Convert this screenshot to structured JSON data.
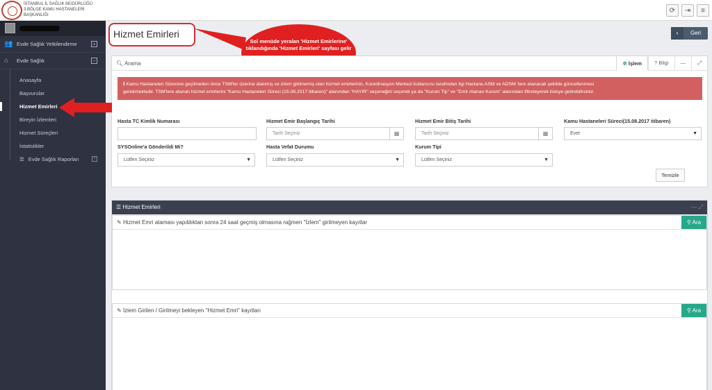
{
  "header": {
    "org_line1": "İSTANBUL İL SAĞLIK MÜDÜRLÜĞÜ",
    "org_line2": "3.BÖLGE KAMU HASTANELERİ",
    "org_line3": "BAŞKANLIĞI",
    "buttons": [
      "refresh-icon",
      "logout-icon",
      "menu-icon"
    ]
  },
  "sidebar": {
    "items": [
      {
        "label": "Evde Sağlık Yetkilendirme",
        "toggle": "+"
      },
      {
        "label": "Evde Sağlık",
        "toggle": "−"
      }
    ],
    "subitems": [
      {
        "label": "Anasayfa"
      },
      {
        "label": "Başvurular"
      },
      {
        "label": "Hizmet Emirleri"
      },
      {
        "label": "Bireyin İzlemleri"
      },
      {
        "label": "Hizmet Süreçleri"
      },
      {
        "label": "İstatistikler"
      },
      {
        "label": "Evde Sağlık Raporları",
        "toggle": "+"
      }
    ]
  },
  "page": {
    "title": "Hizmet Emirleri",
    "back_label": "Geri",
    "callout": "Sol menüde yeralan 'Hizmet Emirlerine' tıklandığında 'Hizmet Emirleri' sayfası gelir"
  },
  "search": {
    "title": "Arama",
    "tabs": [
      "İşlem",
      "Bilgi"
    ],
    "alert_line1": "Kamu Hastaneleri Sürecine geçilmeden önce TSM'ler üzerine atanmış ve izlem girilmemiş olan hizmet emirlerinin, Koordinasyon Merkezi kullanıcısı tarafından ilgi Hastane,ASM ve ADSM 'lere atanacak şekilde güncellenmesi",
    "alert_line2": "gerekmektedir. TSM'lere atanan hizmet emirlerini \"Kamu Hastaneleri Süreci (15.08.2017  itibaren)\" alanından \"HAYIR\" seçeneğini seçerek ya da \"Kurum Tip\" ve \"Emir Atanan Kurum\" alanından filtreleyerek listeye getirebilirsiniz.",
    "fields": {
      "tc_label": "Hasta TC Kimlik Numarası",
      "tc_value": "",
      "start_label": "Hizmet Emir Başlangıç Tarihi",
      "start_placeholder": "Tarih Seçiniz",
      "end_label": "Hizmet Emir Bitiş Tarihi",
      "end_placeholder": "Tarih Seçiniz",
      "kamu_label": "Kamu Hastaneleri Süreci(15.08.2017 itibaren)",
      "kamu_value": "Evet",
      "sys_label": "SYSOnline'a Gönderildi Mi?",
      "sys_value": "Lütfen Seçiniz",
      "vefat_label": "Hasta Vefat Durumu",
      "vefat_value": "Lütfen Seçiniz",
      "kurum_label": "Kurum Tipi",
      "kurum_value": "Lütfen Seçiniz"
    },
    "clear_label": "Temizle"
  },
  "list": {
    "title": "Hizmet Emirleri",
    "section1": "Hizmet Emri ataması yapıldıktan sonra 24 saat geçmiş olmasına rağmen \"İzlem\" girilmeyen kayıtlar",
    "section2": "İzlem Girilen / Girilmeyi bekleyen \"Hizmet Emri\" kayıtları",
    "ara_label": "Ara"
  },
  "colors": {
    "sidebar": "#2f3240",
    "alert": "#d26060",
    "accent_green": "#26a88a",
    "callout_red": "#e02020"
  }
}
